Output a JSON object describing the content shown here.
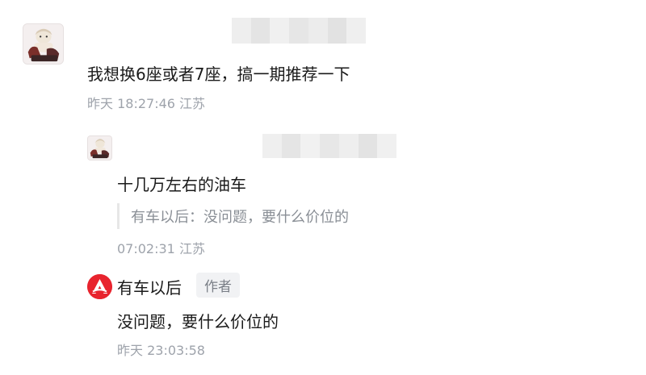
{
  "comment": {
    "avatar_icon": "anime-character-avatar-icon",
    "text": "我想换6座或者7座，搞一期推荐一下",
    "meta": "昨天 18:27:46 江苏"
  },
  "replies": [
    {
      "avatar_icon": "anime-character-avatar-icon",
      "text": "十几万左右的油车",
      "quote": "有车以后：没问题，要什么价位的",
      "meta": "07:02:31 江苏"
    },
    {
      "avatar_icon": "brand-logo-icon",
      "author_name": "有车以后",
      "badge": "作者",
      "text": "没问题，要什么价位的",
      "meta": "昨天 23:03:58"
    }
  ],
  "colors": {
    "text_primary": "#1a1a1a",
    "text_meta": "#9ea3ab",
    "quote_text": "#8a8f96",
    "brand_red": "#e8242e",
    "badge_bg": "#f1f2f4"
  }
}
